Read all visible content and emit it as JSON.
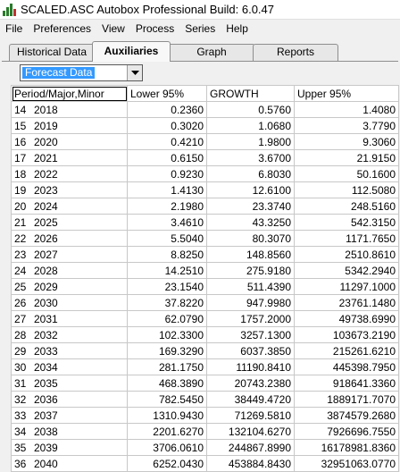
{
  "window": {
    "title": "SCALED.ASC  Autobox Professional Build: 6.0.47"
  },
  "menu": [
    "File",
    "Preferences",
    "View",
    "Process",
    "Series",
    "Help"
  ],
  "tabs": [
    "Historical Data",
    "Auxiliaries",
    "Graph",
    "Reports"
  ],
  "active_tab": "Auxiliaries",
  "dropdown": {
    "value": "Forecast Data"
  },
  "table": {
    "headers": [
      "Period/Major,Minor",
      "Lower 95%",
      "GROWTH",
      "Upper 95%"
    ],
    "rows": [
      [
        "14",
        "2018",
        "0.2360",
        "0.5760",
        "1.4080"
      ],
      [
        "15",
        "2019",
        "0.3020",
        "1.0680",
        "3.7790"
      ],
      [
        "16",
        "2020",
        "0.4210",
        "1.9800",
        "9.3060"
      ],
      [
        "17",
        "2021",
        "0.6150",
        "3.6700",
        "21.9150"
      ],
      [
        "18",
        "2022",
        "0.9230",
        "6.8030",
        "50.1600"
      ],
      [
        "19",
        "2023",
        "1.4130",
        "12.6100",
        "112.5080"
      ],
      [
        "20",
        "2024",
        "2.1980",
        "23.3740",
        "248.5160"
      ],
      [
        "21",
        "2025",
        "3.4610",
        "43.3250",
        "542.3150"
      ],
      [
        "22",
        "2026",
        "5.5040",
        "80.3070",
        "1171.7650"
      ],
      [
        "23",
        "2027",
        "8.8250",
        "148.8560",
        "2510.8610"
      ],
      [
        "24",
        "2028",
        "14.2510",
        "275.9180",
        "5342.2940"
      ],
      [
        "25",
        "2029",
        "23.1540",
        "511.4390",
        "11297.1000"
      ],
      [
        "26",
        "2030",
        "37.8220",
        "947.9980",
        "23761.1480"
      ],
      [
        "27",
        "2031",
        "62.0790",
        "1757.2000",
        "49738.6990"
      ],
      [
        "28",
        "2032",
        "102.3300",
        "3257.1300",
        "103673.2190"
      ],
      [
        "29",
        "2033",
        "169.3290",
        "6037.3850",
        "215261.6210"
      ],
      [
        "30",
        "2034",
        "281.1750",
        "11190.8410",
        "445398.7950"
      ],
      [
        "31",
        "2035",
        "468.3890",
        "20743.2380",
        "918641.3360"
      ],
      [
        "32",
        "2036",
        "782.5450",
        "38449.4720",
        "1889171.7070"
      ],
      [
        "33",
        "2037",
        "1310.9430",
        "71269.5810",
        "3874579.2680"
      ],
      [
        "34",
        "2038",
        "2201.6270",
        "132104.6270",
        "7926696.7550"
      ],
      [
        "35",
        "2039",
        "3706.0610",
        "244867.8990",
        "16178981.8360"
      ],
      [
        "36",
        "2040",
        "6252.0430",
        "453884.8430",
        "32951063.0770"
      ]
    ]
  }
}
